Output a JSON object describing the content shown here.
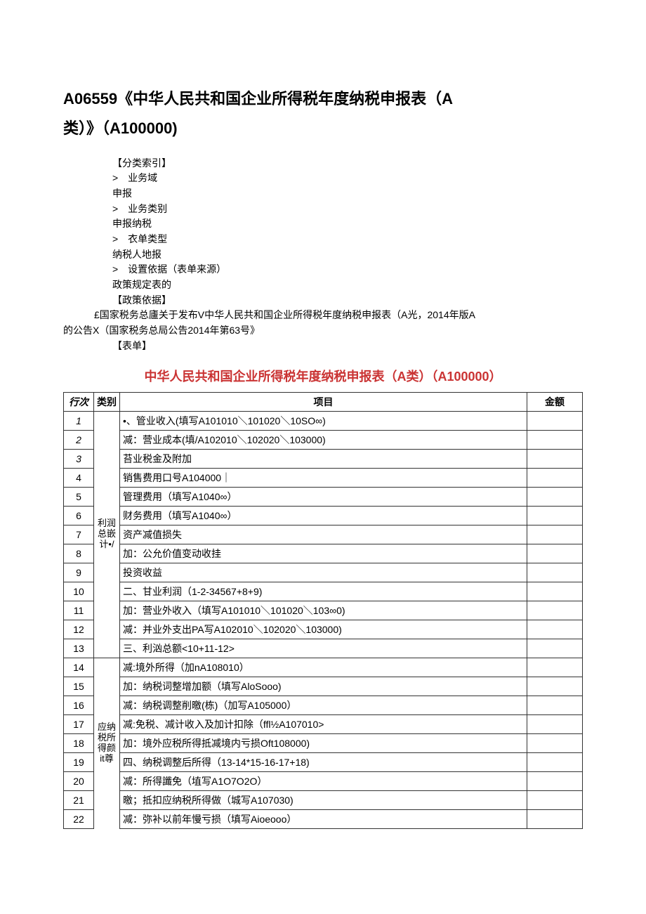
{
  "title_line1": "A06559《中华人民共和国企业所得税年度纳税申报表（A",
  "title_line2": "类）》（A100000)",
  "meta": {
    "index_label": "【分类索引】",
    "row1": ">　业务域",
    "row2": "申报",
    "row3": ">　业务类别",
    "row4": "申报纳税",
    "row5": ">　衣单类型",
    "row6": "纳税人地报",
    "row7": ">　设置依据（表单来源）",
    "row8": "政策规定表的",
    "policy_label": "【政策依据】",
    "policy_body1": "£国家税务总廬关于发布V中华人民共和国企业所得税年度纳税申报表（A光，2014年版A",
    "policy_body2": "的公告X（国家税务总局公告2014年第63号》",
    "form_label": "【表单】"
  },
  "table_title": "中华人民共和国企业所得税年度纳税申报表（A类）（A100000）",
  "headers": {
    "row": "行次",
    "cat": "类别",
    "item": "项目",
    "amount": "金额"
  },
  "cat1": "利润总嵌计•/",
  "cat2": "应纳税所得颜it尊",
  "rows": {
    "r1": {
      "n": "1",
      "item": "•、管业收入(填写A101010＼101020＼10SO∞)"
    },
    "r2": {
      "n": "2",
      "item": "减：营业成本(填/A102010＼102020＼103000)"
    },
    "r3": {
      "n": "3",
      "item": "苔业税金及附加"
    },
    "r4": {
      "n": "4",
      "item": "销售费用口号A104000｜"
    },
    "r5": {
      "n": "5",
      "item": "管理费用（填写A1040∞）"
    },
    "r6": {
      "n": "6",
      "item": "财务费用（填写A1040∞）"
    },
    "r7": {
      "n": "7",
      "item": "资产减值损失"
    },
    "r8": {
      "n": "8",
      "item": "加：公允价值变动收挂"
    },
    "r9": {
      "n": "9",
      "item": "投资收益"
    },
    "r10": {
      "n": "10",
      "item": "二、甘业利润（1-2-34567+8+9)"
    },
    "r11": {
      "n": "11",
      "item": "加：营业外收入（填写A101010＼101020＼103∞0)"
    },
    "r12": {
      "n": "12",
      "item": "减：并业外支出PA写A102010＼102020＼103000)"
    },
    "r13": {
      "n": "13",
      "item": "三、利汹总额<10+11-12>"
    },
    "r14": {
      "n": "14",
      "item": "减:境外所得（加nA108010）"
    },
    "r15": {
      "n": "15",
      "item": "加：纳税词整增加额（填写AloSooo)"
    },
    "r16": {
      "n": "16",
      "item": "减：纳税调整削曒(栋)（加写A105000）"
    },
    "r17": {
      "n": "17",
      "item": "减:免税、减计收入及加计扣除（ffl½A107010>"
    },
    "r18": {
      "n": "18",
      "item": "加：境外应税所得抵减境内亏损Oft108000)"
    },
    "r19": {
      "n": "19",
      "item": "四、纳税调整后所得（13-14*15-16-17+18)"
    },
    "r20": {
      "n": "20",
      "item": "减：所得讖免（埴写A1O7O2O）"
    },
    "r21": {
      "n": "21",
      "item": "曒；抵扣应纳税所得做（城写A107030)"
    },
    "r22": {
      "n": "22",
      "item": "减：弥补以前年慢亏损（填写Aioeooo）"
    }
  }
}
